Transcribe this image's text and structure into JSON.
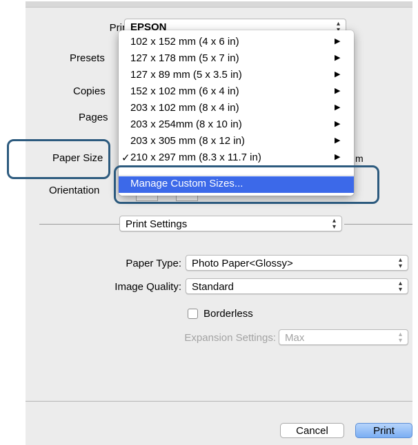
{
  "dialog": {
    "printer": {
      "label": "Printer:",
      "value": "EPSON"
    },
    "presets": {
      "label": "Presets"
    },
    "copies": {
      "label": "Copies"
    },
    "pages": {
      "label": "Pages"
    },
    "paper_size": {
      "label": "Paper Size",
      "suffix": "m"
    },
    "orientation": {
      "label": "Orientation"
    },
    "section_popup": "Print Settings",
    "paper_type": {
      "label": "Paper Type:",
      "value": "Photo Paper<Glossy>"
    },
    "image_quality": {
      "label": "Image Quality:",
      "value": "Standard"
    },
    "borderless": {
      "label": "Borderless",
      "checked": false
    },
    "expansion": {
      "label": "Expansion Settings:",
      "value": "Max"
    },
    "buttons": {
      "cancel": "Cancel",
      "print": "Print"
    }
  },
  "paper_size_menu": {
    "items": [
      {
        "label": "102 x 152 mm (4 x 6 in)",
        "check": "",
        "submenu": "▶"
      },
      {
        "label": "127 x 178 mm (5 x 7 in)",
        "check": "",
        "submenu": "▶"
      },
      {
        "label": "127 x 89 mm (5 x 3.5 in)",
        "check": "",
        "submenu": "▶"
      },
      {
        "label": "152 x 102 mm (6 x 4 in)",
        "check": "",
        "submenu": "▶"
      },
      {
        "label": "203 x 102 mm (8 x 4 in)",
        "check": "",
        "submenu": "▶"
      },
      {
        "label": "203 x 254mm (8 x 10 in)",
        "check": "",
        "submenu": "▶"
      },
      {
        "label": "203 x 305 mm (8 x 12 in)",
        "check": "",
        "submenu": "▶"
      },
      {
        "label": "210 x 297 mm (8.3 x 11.7 in)",
        "check": "✓",
        "submenu": "▶"
      }
    ],
    "manage": "Manage Custom Sizes..."
  },
  "colors": {
    "highlight": "#3c69e9",
    "callout": "#2c5a7e",
    "print_button": "#7aaef3"
  }
}
